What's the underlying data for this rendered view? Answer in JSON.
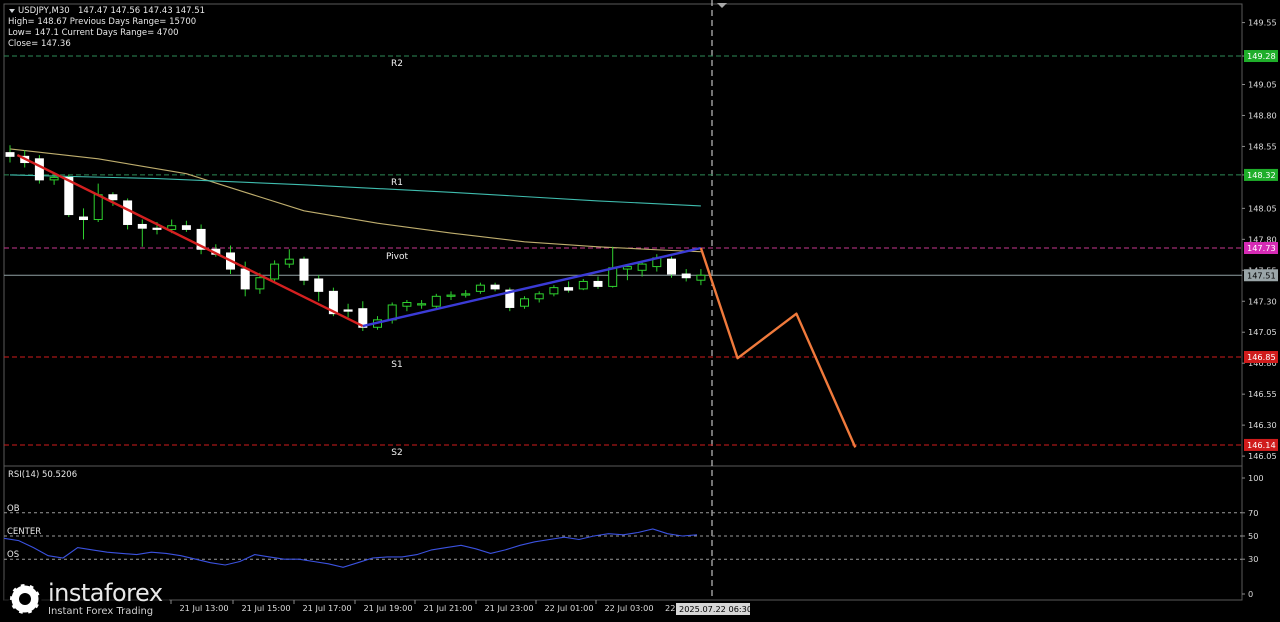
{
  "chart_data": {
    "type": "candlestick",
    "symbol_header": "USDJPY,M30",
    "ohlc_header": "147.47 147.56 147.43 147.51",
    "info_lines": [
      "High= 148.67   Previous Days Range= 15700",
      "Low= 147.1   Current Days Range= 4700",
      "Close= 147.36"
    ],
    "ylim": [
      145.97,
      149.7
    ],
    "y_ticks": [
      "149.55",
      "149.28",
      "149.05",
      "148.80",
      "148.55",
      "148.32",
      "148.05",
      "147.80",
      "147.55",
      "147.30",
      "147.05",
      "146.80",
      "146.55",
      "146.30",
      "146.05"
    ],
    "x_ticks": [
      "21 Jul 13:00",
      "21 Jul 15:00",
      "21 Jul 17:00",
      "21 Jul 19:00",
      "21 Jul 21:00",
      "21 Jul 23:00",
      "22 Jul 01:00",
      "22 Jul 03:00"
    ],
    "current_time_label": "2025.07.22 06:30",
    "levels": [
      {
        "name": "R2",
        "value": 149.28,
        "color": "#2e8b57",
        "label_bg": "#1fae2a",
        "price_label": "149.28"
      },
      {
        "name": "R1",
        "value": 148.32,
        "color": "#2e8b57",
        "label_bg": "#1fae2a",
        "price_label": "148.32"
      },
      {
        "name": "Pivot",
        "value": 147.73,
        "color": "#c8378f",
        "label_bg": "#d62bb5",
        "price_label": "147.73"
      },
      {
        "name": "S1",
        "value": 146.85,
        "color": "#d01c1c",
        "label_bg": "#d01c1c",
        "price_label": "146.85"
      },
      {
        "name": "S2",
        "value": 146.14,
        "color": "#d01c1c",
        "label_bg": "#d01c1c",
        "price_label": "146.14"
      }
    ],
    "current_price": {
      "value": 147.51,
      "label": "147.51",
      "color": "#9aa5a8"
    },
    "candles": [
      {
        "o": 148.5,
        "h": 148.56,
        "l": 148.42,
        "c": 148.47
      },
      {
        "o": 148.47,
        "h": 148.52,
        "l": 148.38,
        "c": 148.42
      },
      {
        "o": 148.45,
        "h": 148.48,
        "l": 148.25,
        "c": 148.28
      },
      {
        "o": 148.28,
        "h": 148.33,
        "l": 148.24,
        "c": 148.3
      },
      {
        "o": 148.3,
        "h": 148.32,
        "l": 147.98,
        "c": 148.0
      },
      {
        "o": 147.98,
        "h": 148.05,
        "l": 147.8,
        "c": 147.96
      },
      {
        "o": 147.96,
        "h": 148.25,
        "l": 147.94,
        "c": 148.16
      },
      {
        "o": 148.16,
        "h": 148.18,
        "l": 148.07,
        "c": 148.12
      },
      {
        "o": 148.11,
        "h": 148.13,
        "l": 147.88,
        "c": 147.92
      },
      {
        "o": 147.92,
        "h": 147.96,
        "l": 147.74,
        "c": 147.89
      },
      {
        "o": 147.89,
        "h": 147.94,
        "l": 147.84,
        "c": 147.88
      },
      {
        "o": 147.88,
        "h": 147.96,
        "l": 147.85,
        "c": 147.91
      },
      {
        "o": 147.91,
        "h": 147.95,
        "l": 147.86,
        "c": 147.88
      },
      {
        "o": 147.88,
        "h": 147.92,
        "l": 147.68,
        "c": 147.72
      },
      {
        "o": 147.72,
        "h": 147.76,
        "l": 147.66,
        "c": 147.68
      },
      {
        "o": 147.69,
        "h": 147.75,
        "l": 147.52,
        "c": 147.56
      },
      {
        "o": 147.56,
        "h": 147.62,
        "l": 147.34,
        "c": 147.4
      },
      {
        "o": 147.4,
        "h": 147.53,
        "l": 147.36,
        "c": 147.49
      },
      {
        "o": 147.48,
        "h": 147.63,
        "l": 147.46,
        "c": 147.6
      },
      {
        "o": 147.6,
        "h": 147.72,
        "l": 147.57,
        "c": 147.64
      },
      {
        "o": 147.64,
        "h": 147.66,
        "l": 147.43,
        "c": 147.47
      },
      {
        "o": 147.48,
        "h": 147.51,
        "l": 147.3,
        "c": 147.38
      },
      {
        "o": 147.38,
        "h": 147.41,
        "l": 147.18,
        "c": 147.2
      },
      {
        "o": 147.23,
        "h": 147.28,
        "l": 147.17,
        "c": 147.22
      },
      {
        "o": 147.24,
        "h": 147.3,
        "l": 147.06,
        "c": 147.09
      },
      {
        "o": 147.09,
        "h": 147.18,
        "l": 147.07,
        "c": 147.15
      },
      {
        "o": 147.15,
        "h": 147.29,
        "l": 147.12,
        "c": 147.27
      },
      {
        "o": 147.26,
        "h": 147.31,
        "l": 147.22,
        "c": 147.29
      },
      {
        "o": 147.27,
        "h": 147.31,
        "l": 147.24,
        "c": 147.28
      },
      {
        "o": 147.26,
        "h": 147.36,
        "l": 147.24,
        "c": 147.34
      },
      {
        "o": 147.34,
        "h": 147.38,
        "l": 147.31,
        "c": 147.35
      },
      {
        "o": 147.35,
        "h": 147.39,
        "l": 147.33,
        "c": 147.36
      },
      {
        "o": 147.38,
        "h": 147.45,
        "l": 147.36,
        "c": 147.43
      },
      {
        "o": 147.43,
        "h": 147.45,
        "l": 147.38,
        "c": 147.4
      },
      {
        "o": 147.39,
        "h": 147.41,
        "l": 147.22,
        "c": 147.25
      },
      {
        "o": 147.26,
        "h": 147.34,
        "l": 147.24,
        "c": 147.32
      },
      {
        "o": 147.32,
        "h": 147.38,
        "l": 147.29,
        "c": 147.36
      },
      {
        "o": 147.36,
        "h": 147.43,
        "l": 147.34,
        "c": 147.41
      },
      {
        "o": 147.41,
        "h": 147.46,
        "l": 147.37,
        "c": 147.39
      },
      {
        "o": 147.4,
        "h": 147.48,
        "l": 147.39,
        "c": 147.46
      },
      {
        "o": 147.46,
        "h": 147.5,
        "l": 147.4,
        "c": 147.42
      },
      {
        "o": 147.42,
        "h": 147.74,
        "l": 147.41,
        "c": 147.57
      },
      {
        "o": 147.56,
        "h": 147.6,
        "l": 147.47,
        "c": 147.58
      },
      {
        "o": 147.55,
        "h": 147.62,
        "l": 147.5,
        "c": 147.6
      },
      {
        "o": 147.58,
        "h": 147.68,
        "l": 147.54,
        "c": 147.65
      },
      {
        "o": 147.64,
        "h": 147.66,
        "l": 147.49,
        "c": 147.52
      },
      {
        "o": 147.52,
        "h": 147.56,
        "l": 147.46,
        "c": 147.49
      },
      {
        "o": 147.47,
        "h": 147.56,
        "l": 147.43,
        "c": 147.51
      }
    ],
    "moving_averages": [
      {
        "color": "#bfae6e",
        "points": [
          [
            0,
            148.53
          ],
          [
            6,
            148.45
          ],
          [
            12,
            148.33
          ],
          [
            16,
            148.18
          ],
          [
            20,
            148.03
          ],
          [
            25,
            147.93
          ],
          [
            30,
            147.85
          ],
          [
            35,
            147.78
          ],
          [
            40,
            147.74
          ],
          [
            45,
            147.71
          ],
          [
            47,
            147.7
          ]
        ]
      },
      {
        "color": "#3fbcae",
        "points": [
          [
            0,
            148.32
          ],
          [
            10,
            148.29
          ],
          [
            20,
            148.24
          ],
          [
            30,
            148.18
          ],
          [
            40,
            148.11
          ],
          [
            47,
            148.07
          ]
        ]
      }
    ],
    "trend_lines": [
      {
        "color": "#d42020",
        "from": [
          0.5,
          148.48
        ],
        "to": [
          24,
          147.1
        ]
      },
      {
        "color": "#3b3bd6",
        "from": [
          24,
          147.1
        ],
        "to": [
          47,
          147.73
        ]
      }
    ],
    "projection": {
      "color": "#f07a3c",
      "points": [
        [
          47,
          147.73
        ],
        [
          49.5,
          146.84
        ],
        [
          53.5,
          147.2
        ],
        [
          57.5,
          146.12
        ]
      ]
    },
    "rsi": {
      "header": "RSI(14) 50.5206",
      "ylim": [
        0,
        100
      ],
      "levels": [
        {
          "name": "OB",
          "value": 70
        },
        {
          "name": "CENTER",
          "value": 50
        },
        {
          "name": "OS",
          "value": 30
        }
      ],
      "tick_labels": [
        "100",
        "70",
        "50",
        "30",
        "0"
      ],
      "values": [
        48,
        46,
        40,
        33,
        31,
        40,
        38,
        36,
        35,
        34,
        36,
        35,
        33,
        30,
        27,
        25,
        28,
        34,
        32,
        30,
        30,
        28,
        26,
        23,
        27,
        31,
        32,
        32,
        34,
        38,
        40,
        42,
        39,
        35,
        38,
        42,
        45,
        47,
        49,
        47,
        50,
        52,
        51,
        53,
        56,
        52,
        50,
        51
      ]
    }
  }
}
